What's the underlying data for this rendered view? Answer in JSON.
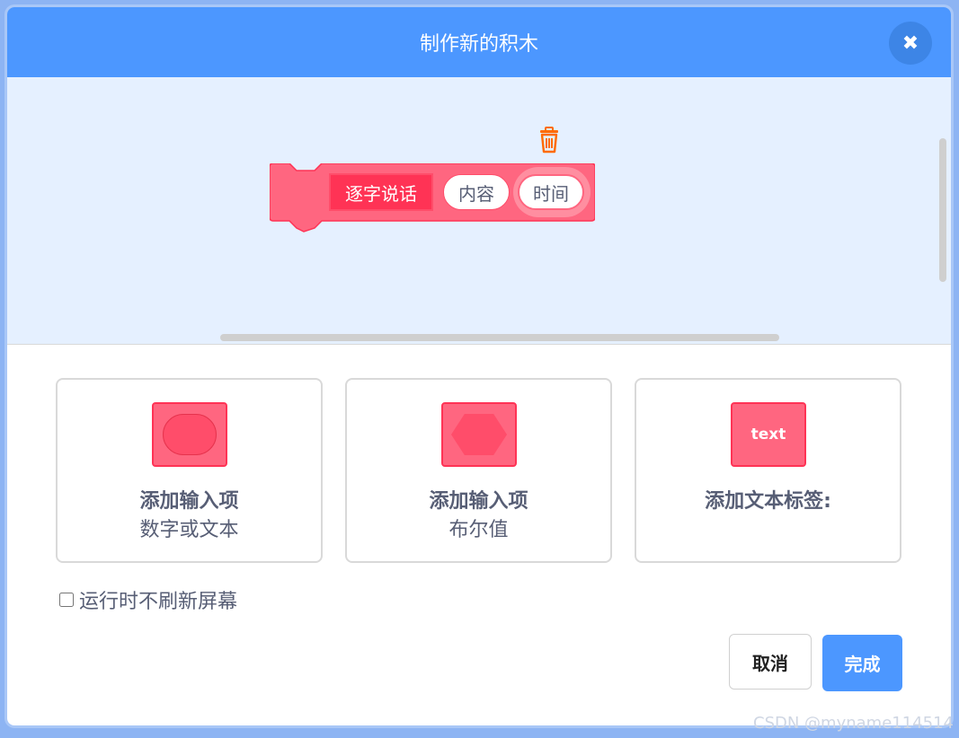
{
  "dialog": {
    "title": "制作新的积木",
    "close_icon": "close-icon"
  },
  "workspace": {
    "trash_icon": "trash-icon",
    "block": {
      "label": "逐字说话",
      "inputs": [
        "内容",
        "时间"
      ],
      "color": "#ff6680",
      "selected_input": "时间"
    }
  },
  "options": [
    {
      "icon": "oval-input-icon",
      "title": "添加输入项",
      "subtitle": "数字或文本"
    },
    {
      "icon": "boolean-input-icon",
      "title": "添加输入项",
      "subtitle": "布尔值"
    },
    {
      "icon": "text-label-icon",
      "icon_text": "text",
      "title": "添加文本标签:",
      "subtitle": ""
    }
  ],
  "run_without_refresh": {
    "label": "运行时不刷新屏幕",
    "checked": false
  },
  "buttons": {
    "cancel": "取消",
    "ok": "完成"
  },
  "colors": {
    "header": "#4c97ff",
    "workspace_bg": "#e5f0ff",
    "block_pink": "#ff6680",
    "block_label": "#ff3355"
  },
  "watermark": "CSDN @myname114514"
}
